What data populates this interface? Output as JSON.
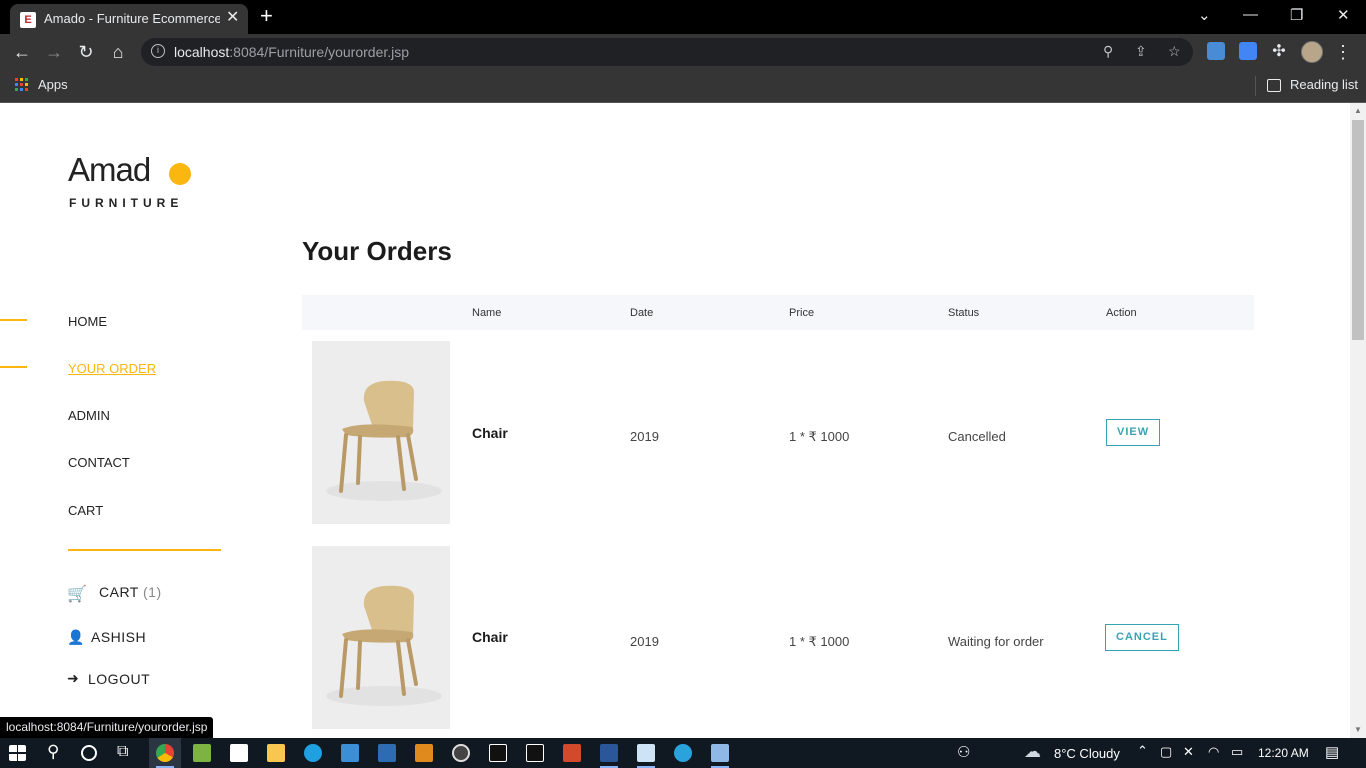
{
  "browser": {
    "tab_title": "Amado - Furniture Ecommerce Te",
    "tab_favicon_letter": "E",
    "tab_close": "✕",
    "new_tab": "+",
    "url_host": "localhost",
    "url_rest": ":8084/Furniture/yourorder.jsp",
    "bookmarks": {
      "apps_label": "Apps",
      "reading_list_label": "Reading list"
    },
    "window_controls": {
      "minimize": "—",
      "maximize": "❐",
      "close": "✕",
      "dropdown": "⌄"
    }
  },
  "site": {
    "logo_word": "Amad",
    "logo_sub": "FURNITURE",
    "nav": [
      {
        "label": "HOME",
        "active": false
      },
      {
        "label": "YOUR ORDER",
        "active": true
      },
      {
        "label": "ADMIN",
        "active": false
      },
      {
        "label": "CONTACT",
        "active": false
      },
      {
        "label": "CART",
        "active": false
      }
    ],
    "cart_label": "CART",
    "cart_count": "(1)",
    "user_name": "ASHISH",
    "logout_label": "LOGOUT",
    "accent_color": "#fbb710",
    "action_color": "#3aa3b2"
  },
  "orders": {
    "title": "Your Orders",
    "columns": [
      "Name",
      "Date",
      "Price",
      "Status",
      "Action"
    ],
    "rows": [
      {
        "name": "Chair",
        "date": "2019",
        "price": "1 * ₹ 1000",
        "status": "Cancelled",
        "action": "VIEW"
      },
      {
        "name": "Chair",
        "date": "2019",
        "price": "1 * ₹ 1000",
        "status": "Waiting for order",
        "action": "CANCEL"
      }
    ]
  },
  "status_bar_url": "localhost:8084/Furniture/yourorder.jsp",
  "taskbar": {
    "weather": "8°C  Cloudy",
    "time": "12:20 AM"
  }
}
